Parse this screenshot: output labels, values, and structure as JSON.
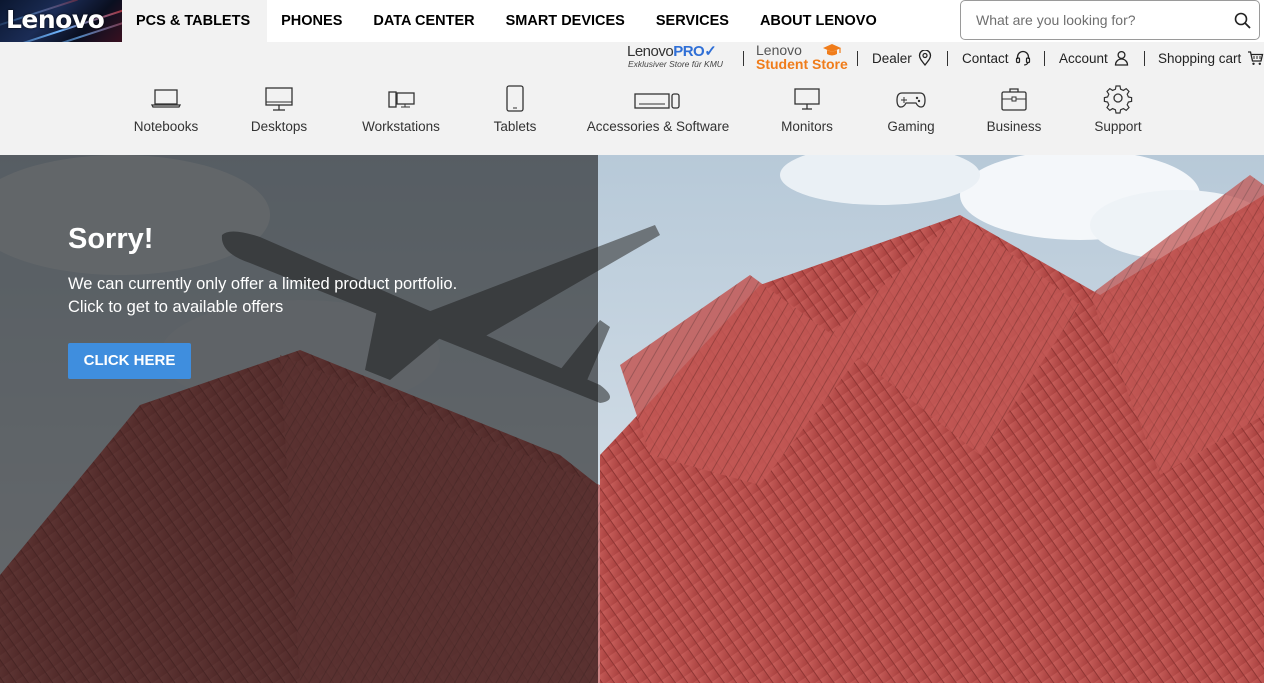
{
  "brand": {
    "logo_text": "Lenovo"
  },
  "main_nav": [
    {
      "label": "PCS & TABLETS",
      "active": true
    },
    {
      "label": "PHONES"
    },
    {
      "label": "DATA CENTER"
    },
    {
      "label": "SMART DEVICES"
    },
    {
      "label": "SERVICES"
    },
    {
      "label": "ABOUT LENOVO"
    }
  ],
  "search": {
    "placeholder": "What are you looking for?"
  },
  "pro_store": {
    "brand_prefix": "Lenovo",
    "brand_suffix": "PRO",
    "tagline": "Exklusiver Store für KMU"
  },
  "student_store": {
    "line1": "Lenovo",
    "line2": "Student Store"
  },
  "utility_links": {
    "dealer": "Dealer",
    "contact": "Contact",
    "account": "Account",
    "cart": "Shopping cart"
  },
  "categories": [
    {
      "label": "Notebooks",
      "icon": "notebook-icon"
    },
    {
      "label": "Desktops",
      "icon": "desktop-icon"
    },
    {
      "label": "Workstations",
      "icon": "workstation-icon"
    },
    {
      "label": "Tablets",
      "icon": "tablet-icon"
    },
    {
      "label": "Accessories & Software",
      "icon": "accessories-icon"
    },
    {
      "label": "Monitors",
      "icon": "monitor-icon"
    },
    {
      "label": "Gaming",
      "icon": "gamepad-icon"
    },
    {
      "label": "Business",
      "icon": "briefcase-icon"
    },
    {
      "label": "Support",
      "icon": "gear-icon"
    }
  ],
  "hero": {
    "title": "Sorry!",
    "line1": "We can currently only offer a limited product portfolio.",
    "line2": "Click to get to available offers",
    "cta": "CLICK HERE"
  },
  "colors": {
    "cta": "#3f8ede",
    "student_accent": "#f07c1a",
    "pro_accent": "#2f6fd6",
    "overlay": "rgba(28,28,28,0.62)"
  }
}
